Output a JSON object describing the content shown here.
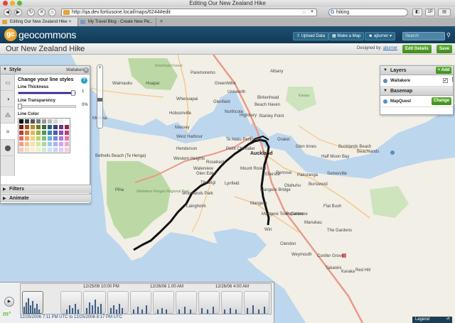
{
  "browser": {
    "window_title": "Editing Our New Zealand Hike",
    "url": "http://qa.dev.fortiusone.local/maps/6244#edit",
    "search_value": "hiking",
    "tabs": [
      {
        "label": "Editing Our New Zealand Hike",
        "active": true
      },
      {
        "label": "My Travel Blog - Create New Po...",
        "active": false
      }
    ],
    "toolbar_badge": "1P"
  },
  "app": {
    "logo_mark": "gc",
    "logo_text": "geocommons",
    "upload_label": "Upload Data",
    "make_map_label": "Make a Map",
    "user_label": "ajturner",
    "search_placeholder": "Search"
  },
  "map_header": {
    "title": "Our New Zealand Hike",
    "designed_by_label": "Designed by:",
    "designer": "ajturner",
    "edit_details_label": "Edit Details",
    "save_label": "Save"
  },
  "style_panel": {
    "title": "Style",
    "layer_name": "Waitakere",
    "heading": "Change your line styles",
    "help": "?",
    "thickness_label": "Line Thickness",
    "thickness_value": "1",
    "thickness_fraction": 0.95,
    "transparency_label": "Line Transparency",
    "transparency_value": "0%",
    "transparency_fraction": 0.0,
    "color_label": "Line Color",
    "swatches": [
      "#000000",
      "#3a3a3a",
      "#555555",
      "#777777",
      "#999999",
      "#bbbbbb",
      "#d5d5d5",
      "#eeeeee",
      "#ffffff",
      "#7a1a10",
      "#a5531a",
      "#b88a2a",
      "#6d7a2a",
      "#3d6a3a",
      "#2f5e7a",
      "#3a3a7a",
      "#6a3a7a",
      "#8a2a4a",
      "#c23a2a",
      "#d67a2a",
      "#e3b84a",
      "#9ab83a",
      "#4e9a4e",
      "#3a8ab8",
      "#4a5ab8",
      "#8a4ab8",
      "#c23a7a",
      "#e06a5a",
      "#eea05a",
      "#f2d27a",
      "#bcd66a",
      "#7cc07c",
      "#6ab0de",
      "#7a8ade",
      "#b07ade",
      "#e07aaa",
      "#f09a8a",
      "#f6c08a",
      "#f8e2a4",
      "#d6e89a",
      "#a8d8a8",
      "#9acaec",
      "#a8b2ec",
      "#cca8ec",
      "#f0a8c8",
      "#f8c8bc",
      "#fbdcbc",
      "#fcf0cc",
      "#eaf4c8",
      "#cceccc",
      "#c8e2f6",
      "#ccd2f6",
      "#e2ccf6",
      "#f8ccdf"
    ],
    "filters_label": "Filters",
    "animate_label": "Animate"
  },
  "layers_panel": {
    "title": "Layers",
    "add_label": "+ Add",
    "layer_name": "Waitakere",
    "basemap_title": "Basemap",
    "basemap_name": "MapQuest",
    "change_label": "Change"
  },
  "map": {
    "places": [
      {
        "name": "Riverhead Forest",
        "cls": "park"
      },
      {
        "name": "Paremoremo",
        "cls": ""
      },
      {
        "name": "Albany",
        "cls": ""
      },
      {
        "name": "Waimauku",
        "cls": ""
      },
      {
        "name": "Huapai",
        "cls": ""
      },
      {
        "name": "Greenhithe",
        "cls": ""
      },
      {
        "name": "Unsworth",
        "cls": ""
      },
      {
        "name": "Whenuapai",
        "cls": ""
      },
      {
        "name": "Glenfield",
        "cls": ""
      },
      {
        "name": "Birkenhead",
        "cls": ""
      },
      {
        "name": "Beach Haven",
        "cls": ""
      },
      {
        "name": "Northcote",
        "cls": ""
      },
      {
        "name": "Highbury",
        "cls": ""
      },
      {
        "name": "Stanley Point",
        "cls": ""
      },
      {
        "name": "Hobsonville",
        "cls": ""
      },
      {
        "name": "Muriwai",
        "cls": ""
      },
      {
        "name": "Massey",
        "cls": ""
      },
      {
        "name": "West Harbour",
        "cls": ""
      },
      {
        "name": "Te Atatu Peninsula",
        "cls": ""
      },
      {
        "name": "Henderson",
        "cls": ""
      },
      {
        "name": "Point Chevalier",
        "cls": ""
      },
      {
        "name": "Auckland",
        "cls": "big"
      },
      {
        "name": "Orakei",
        "cls": ""
      },
      {
        "name": "Glen Innes",
        "cls": ""
      },
      {
        "name": "Bucklands Beach",
        "cls": ""
      },
      {
        "name": "Beachlands",
        "cls": ""
      },
      {
        "name": "Bethells Beach (Te Henga)",
        "cls": ""
      },
      {
        "name": "Western Heights",
        "cls": ""
      },
      {
        "name": "Rosebank",
        "cls": ""
      },
      {
        "name": "Waterview",
        "cls": ""
      },
      {
        "name": "Glen Eden",
        "cls": ""
      },
      {
        "name": "Mount Roskill",
        "cls": ""
      },
      {
        "name": "Ellerslie",
        "cls": ""
      },
      {
        "name": "Penrose",
        "cls": ""
      },
      {
        "name": "Pakuranga",
        "cls": ""
      },
      {
        "name": "Half Moon Bay",
        "cls": ""
      },
      {
        "name": "Somerville",
        "cls": ""
      },
      {
        "name": "Lynfield",
        "cls": ""
      },
      {
        "name": "Mangere Bridge",
        "cls": ""
      },
      {
        "name": "Otahuhu",
        "cls": ""
      },
      {
        "name": "Burswood",
        "cls": ""
      },
      {
        "name": "Piha",
        "cls": ""
      },
      {
        "name": "Titirangi",
        "cls": ""
      },
      {
        "name": "Woodlands Park",
        "cls": ""
      },
      {
        "name": "Laingholm",
        "cls": ""
      },
      {
        "name": "Waitakere Ranges Regional Park",
        "cls": "park"
      },
      {
        "name": "Mangere",
        "cls": ""
      },
      {
        "name": "Mangere Town Centre",
        "cls": ""
      },
      {
        "name": "Papatoetoe",
        "cls": ""
      },
      {
        "name": "Flat Bush",
        "cls": ""
      },
      {
        "name": "Manukau",
        "cls": ""
      },
      {
        "name": "The Gardens",
        "cls": ""
      },
      {
        "name": "Wiri",
        "cls": ""
      },
      {
        "name": "Clendon",
        "cls": ""
      },
      {
        "name": "Weymouth",
        "cls": ""
      },
      {
        "name": "Conifer Grove",
        "cls": ""
      },
      {
        "name": "Takanini",
        "cls": ""
      },
      {
        "name": "Karaka",
        "cls": ""
      },
      {
        "name": "Red Hill",
        "cls": ""
      },
      {
        "name": "Kawau",
        "cls": "park"
      }
    ]
  },
  "timeline": {
    "play_icon": "play-icon",
    "tick_labels": [
      "12/25/06 10:00 PM",
      "12/26/06 1:00 AM",
      "12/26/06 4:00 AM"
    ],
    "range_text": "12/25/2006 7:11 PM UTC to 12/25/2006 8:17 PM UTC",
    "legend_label": "Legend"
  },
  "colors": {
    "header": "#1d4f70",
    "accent_green": "#4f9e28",
    "water": "#bcd6ee",
    "land": "#f2efe6",
    "park": "#bcd9a5",
    "track": "#111111"
  }
}
